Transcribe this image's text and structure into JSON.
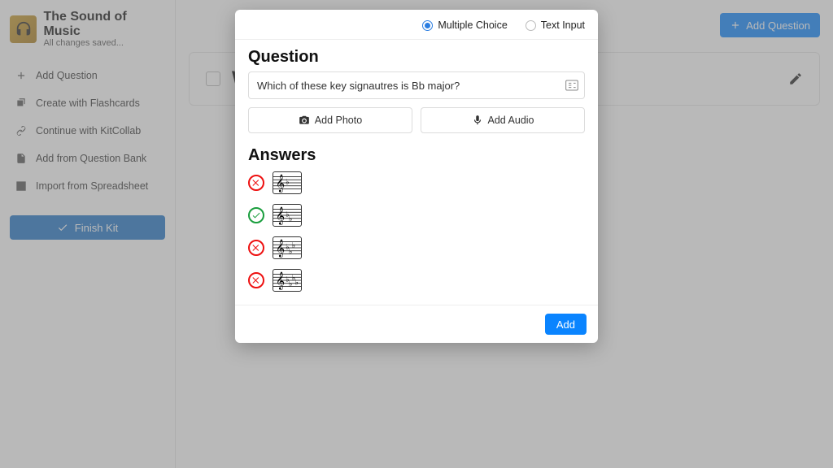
{
  "header": {
    "kit_title": "The Sound of Music",
    "save_status": "All changes saved..."
  },
  "sidebar": {
    "items": [
      {
        "label": "Add Question"
      },
      {
        "label": "Create with Flashcards"
      },
      {
        "label": "Continue with KitCollab"
      },
      {
        "label": "Add from Question Bank"
      },
      {
        "label": "Import from Spreadsheet"
      }
    ],
    "finish_label": "Finish Kit"
  },
  "topbar": {
    "add_question_label": "Add Question"
  },
  "question_list": {
    "first_question_preview": "Wh"
  },
  "modal": {
    "question_types": {
      "multiple_choice": "Multiple Choice",
      "text_input": "Text Input",
      "selected": "multiple_choice"
    },
    "section_question": "Question",
    "question_text": "Which of these key signautres is Bb major?",
    "add_photo_label": "Add Photo",
    "add_audio_label": "Add Audio",
    "section_answers": "Answers",
    "answers": [
      {
        "correct": false,
        "flats": 1
      },
      {
        "correct": true,
        "flats": 2
      },
      {
        "correct": false,
        "flats": 3
      },
      {
        "correct": false,
        "flats": 4
      }
    ],
    "add_button_label": "Add"
  }
}
